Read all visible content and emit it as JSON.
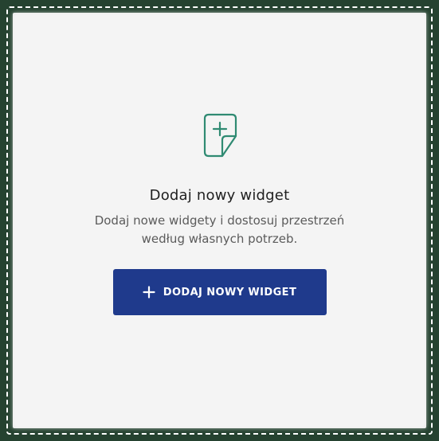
{
  "widget_placeholder": {
    "icon": "add-note-icon",
    "title": "Dodaj nowy widget",
    "description_line1": "Dodaj nowe widgety i dostosuj przestrzeń",
    "description_line2": "według własnych potrzeb.",
    "button_icon": "plus-icon",
    "button_label": "DODAJ NOWY WIDGET"
  },
  "colors": {
    "page_background": "#254230",
    "card_background": "#f4f4f4",
    "icon_accent": "#2f8a72",
    "button_background": "#1f3a8c",
    "button_text": "#ffffff"
  }
}
